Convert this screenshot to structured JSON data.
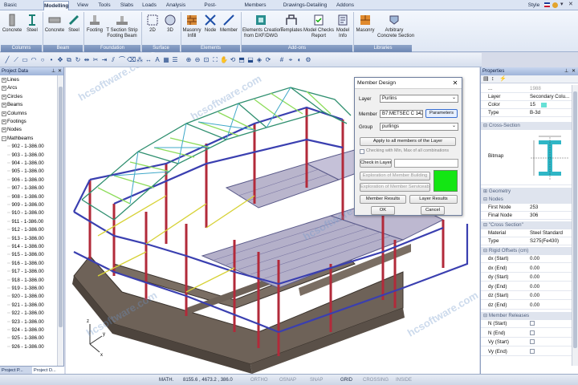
{
  "menu": {
    "tabs": [
      "Basic",
      "Modelling",
      "View",
      "Tools",
      "Slabs",
      "Loads",
      "Analysis",
      "Post-Processor",
      "Members Design",
      "Drawings-Detailing",
      "Addons"
    ],
    "active_tab": "Modelling",
    "style_label": "Style"
  },
  "ribbon": {
    "buttons": [
      {
        "label": "Concrete",
        "icon": "concrete-column-icon"
      },
      {
        "label": "Steel",
        "icon": "steel-column-icon"
      },
      {
        "label": "Concrete",
        "icon": "concrete-beam-icon"
      },
      {
        "label": "Steel",
        "icon": "steel-beam-icon"
      },
      {
        "label": "Footing",
        "icon": "footing-icon"
      },
      {
        "label": "T Section Strip\nFooting Beam",
        "icon": "strip-footing-icon"
      },
      {
        "label": "2D",
        "icon": "surface-2d-icon"
      },
      {
        "label": "3D",
        "icon": "surface-3d-icon"
      },
      {
        "label": "Masonry\nInfill",
        "icon": "masonry-infill-icon"
      },
      {
        "label": "Node",
        "icon": "node-icon"
      },
      {
        "label": "Member",
        "icon": "member-icon"
      },
      {
        "label": "Elements Creation\nfrom DXF/DWG",
        "icon": "dxf-import-icon"
      },
      {
        "label": "Templates",
        "icon": "templates-icon"
      },
      {
        "label": "Model Checks\nReport",
        "icon": "model-checks-icon"
      },
      {
        "label": "Model\nInfo",
        "icon": "model-info-icon"
      },
      {
        "label": "Masonry",
        "icon": "masonry-icon"
      },
      {
        "label": "Arbitrary\nConcrete Section",
        "icon": "arbitrary-section-icon"
      }
    ],
    "groups": [
      "Columns",
      "Beam",
      "Foundation",
      "Surface Elements",
      "Elements",
      "Add-ons",
      "Libraries"
    ]
  },
  "left_panel": {
    "title": "Project Data",
    "tree_items": [
      "Lines",
      "Arcs",
      "Circles",
      "Beams",
      "Columns",
      "Footings",
      "Nodes",
      "Mathbeams"
    ],
    "mathbeams": [
      "902 - 1-386.00",
      "903 - 1-386.00",
      "904 - 1-386.00",
      "905 - 1-386.00",
      "906 - 1-386.00",
      "907 - 1-386.00",
      "908 - 1-386.00",
      "909 - 1-386.00",
      "910 - 1-386.00",
      "911 - 1-386.00",
      "912 - 1-386.00",
      "913 - 1-386.00",
      "914 - 1-386.00",
      "915 - 1-386.00",
      "916 - 1-386.00",
      "917 - 1-386.00",
      "918 - 1-386.00",
      "919 - 1-386.00",
      "920 - 1-386.00",
      "921 - 1-386.00",
      "922 - 1-386.00",
      "923 - 1-386.00",
      "924 - 1-386.00",
      "925 - 1-386.00",
      "926 - 1-386.00"
    ],
    "tabs": [
      "Project P...",
      "Project D..."
    ]
  },
  "right_panel": {
    "title": "Properties",
    "top_rows": [
      {
        "key": "...",
        "value": "1988"
      },
      {
        "key": "Layer",
        "value": "Secondary Colu..."
      },
      {
        "key": "Color",
        "value": "15"
      },
      {
        "key": "Type",
        "value": "B-3d"
      }
    ],
    "cross_section_label": "Cross-Section",
    "bitmap_label": "Bitmap",
    "geometry_label": "Geometry",
    "nodes_label": "Nodes",
    "node_rows": [
      {
        "key": "First Node",
        "value": "253"
      },
      {
        "key": "Final Node",
        "value": "306"
      }
    ],
    "cross_section2_label": "\"Cross Section\"",
    "section_rows": [
      {
        "key": "Material",
        "value": "Steel Standard"
      },
      {
        "key": "Type",
        "value": "S275(Fe430)"
      }
    ],
    "rigid_label": "Rigid Offsets (cm)",
    "rigid_rows": [
      {
        "key": "dx (Start)",
        "value": "0.00"
      },
      {
        "key": "dx (End)",
        "value": "0.00"
      },
      {
        "key": "dy (Start)",
        "value": "0.00"
      },
      {
        "key": "dy (End)",
        "value": "0.00"
      },
      {
        "key": "dz (Start)",
        "value": "0.00"
      },
      {
        "key": "dz (End)",
        "value": "0.00"
      }
    ],
    "releases_label": "Member Releases",
    "release_rows": [
      "N (Start)",
      "N (End)",
      "Vy (Start)",
      "Vy (End)"
    ],
    "color_swatch": "#66e0d6"
  },
  "dialog": {
    "title": "Member Design",
    "layer_label": "Layer",
    "layer_value": "Purlins",
    "member_label": "Member",
    "member_value": "B7:METSEC C 142",
    "parameters_button": "Parameters",
    "group_label": "Group",
    "group_value": "purlings",
    "apply_button": "Apply to all members of the Layer",
    "check_minmax": "Checking with Min, Max of all combinations",
    "check_layer_button": "Check in Layer",
    "exploration_building": "Exploration of Member Building",
    "exploration_serviceability": "Exploration of Member Serviceability",
    "member_results_button": "Member Results",
    "layer_results_button": "Layer Results",
    "ok_button": "OK",
    "cancel_button": "Cancel",
    "status_color": "#13e613"
  },
  "statusbar": {
    "math": "MATH.",
    "coords": "8155.6 , 4673.2 , 386.0",
    "toggles": [
      {
        "label": "ORTHO",
        "on": false
      },
      {
        "label": "OSNAP",
        "on": false
      },
      {
        "label": "SNAP",
        "on": false
      },
      {
        "label": "GRID",
        "on": true
      },
      {
        "label": "CROSSING",
        "on": false
      },
      {
        "label": "INSIDE",
        "on": false
      }
    ]
  },
  "axes": {
    "x": "x",
    "y": "y",
    "z": "z"
  },
  "watermarks": [
    "hcsoftware.com",
    "hcsoftware.com",
    "hcsoftware.com",
    "hcsoftware.com",
    "hcsoftware.com"
  ]
}
